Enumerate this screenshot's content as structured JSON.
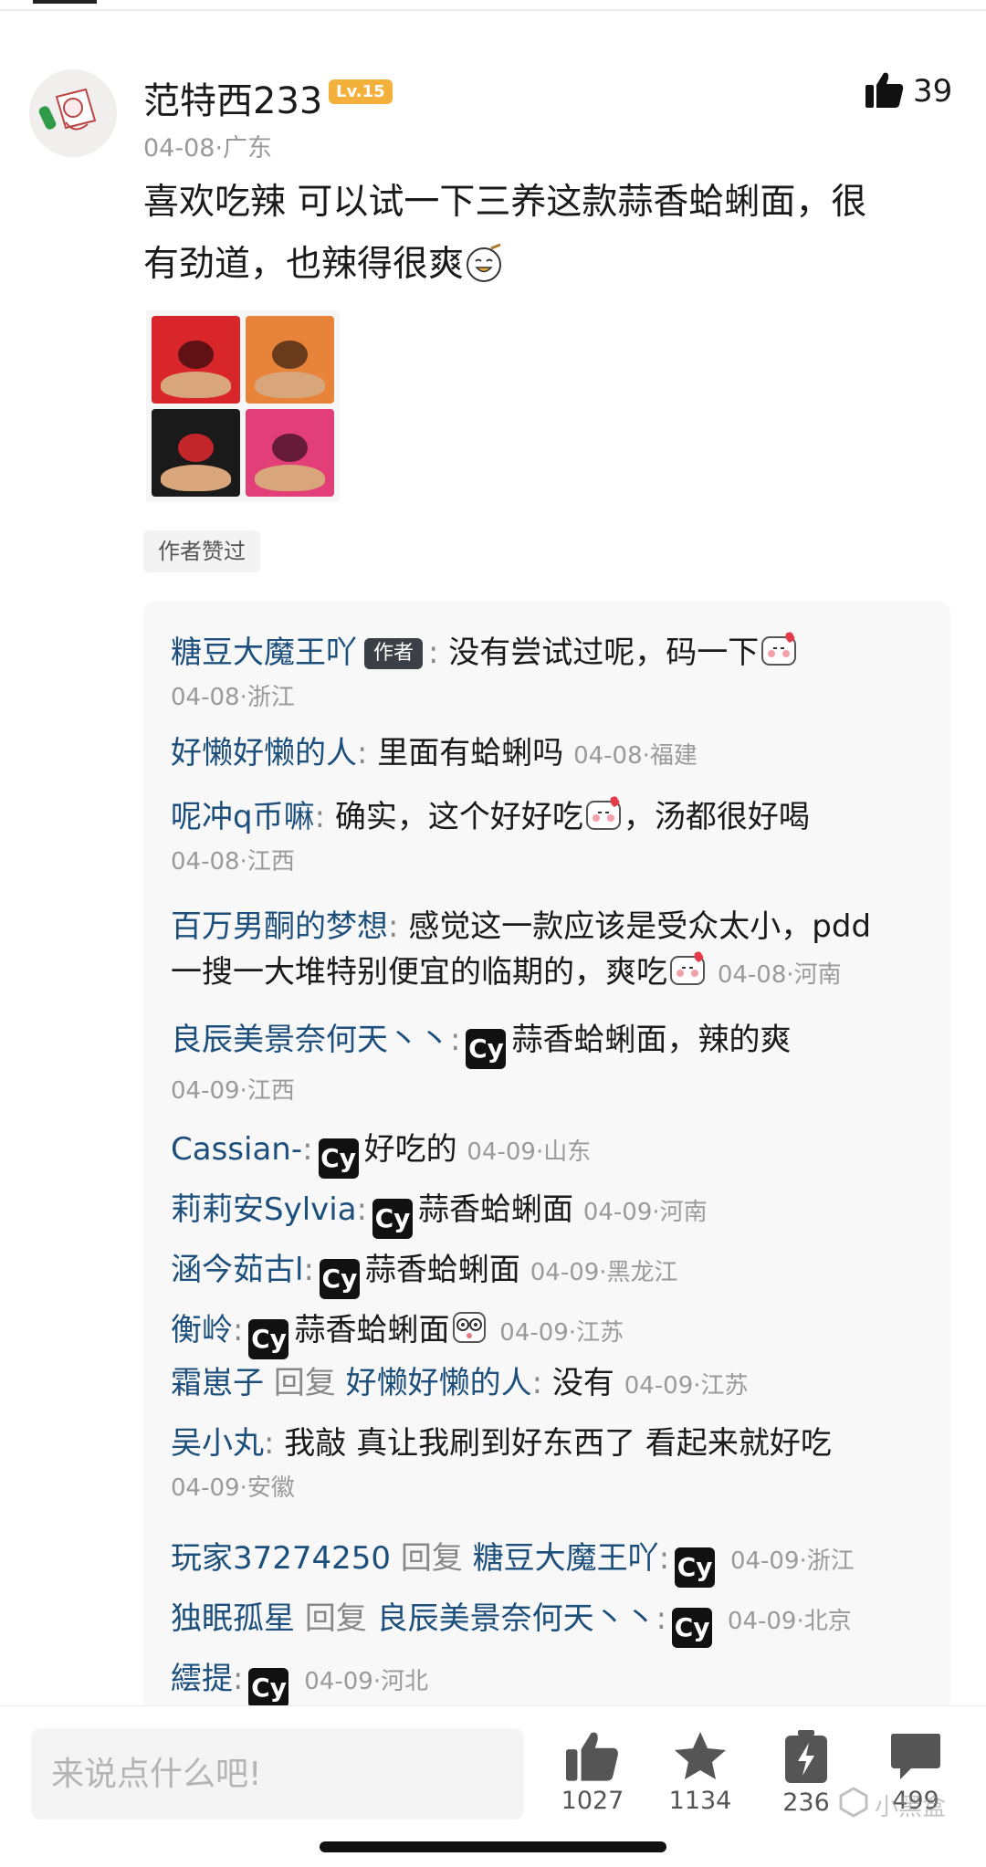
{
  "post": {
    "username": "范特西233",
    "level": "Lv.15",
    "like_count": "39",
    "date": "04-08",
    "location": "广东",
    "text_line1": "喜欢吃辣 可以试一下三养这款蒜香蛤蜊面，很",
    "text_line2": "有劲道，也辣得很爽",
    "author_liked": "作者赞过"
  },
  "replies": [
    {
      "name": "糖豆大魔王吖",
      "tag": "作者",
      "sep": ":",
      "text": "没有尝试过呢，码一下",
      "time": "04-08·浙江"
    },
    {
      "name": "好懒好懒的人",
      "sep": ":",
      "text": "里面有蛤蜊吗",
      "time": "04-08·福建"
    },
    {
      "name": "呢冲q币嘛",
      "sep": ":",
      "text": "确实，这个好好吃",
      "text2": "，汤都很好喝",
      "time": "04-08·江西"
    },
    {
      "name": "百万男酮的梦想",
      "sep": ":",
      "text": "感觉这一款应该是受众太小，pdd",
      "text2": "一搜一大堆特别便宜的临期的，爽吃",
      "time": "04-08·河南"
    },
    {
      "name": "良辰美景奈何天丶丶",
      "sep": ":",
      "cy": "Cy",
      "text": "蒜香蛤蜊面，辣的爽",
      "time": "04-09·江西"
    },
    {
      "name": "Cassian-",
      "sep": ":",
      "cy": "Cy",
      "text": "好吃的",
      "time": "04-09·山东"
    },
    {
      "name": "莉莉安Sylvia",
      "sep": ":",
      "cy": "Cy",
      "text": "蒜香蛤蜊面",
      "time": "04-09·河南"
    },
    {
      "name": "涵今茹古l",
      "sep": ":",
      "cy": "Cy",
      "text": "蒜香蛤蜊面",
      "time": "04-09·黑龙江"
    },
    {
      "name": "衡岭",
      "sep": ":",
      "cy": "Cy",
      "text": "蒜香蛤蜊面",
      "time": "04-09·江苏"
    },
    {
      "name": "霜崽子",
      "reply_word": "回复",
      "reply_to": "好懒好懒的人",
      "sep": ":",
      "text": "没有",
      "time": "04-09·江苏"
    },
    {
      "name": "吴小丸",
      "sep": ":",
      "text": "我敲 真让我刷到好东西了 看起来就好吃",
      "time": "04-09·安徽"
    },
    {
      "name": "玩家37274250",
      "reply_word": "回复",
      "reply_to": "糖豆大魔王吖",
      "sep": ":",
      "cy": "Cy",
      "time": "04-09·浙江"
    },
    {
      "name": "独眠孤星",
      "reply_word": "回复",
      "reply_to": "良辰美景奈何天丶丶",
      "sep": ":",
      "cy": "Cy",
      "time": "04-09·北京"
    },
    {
      "name": "繧提",
      "sep": ":",
      "cy": "Cy",
      "time": "04-09·河北"
    }
  ],
  "bottom": {
    "input_placeholder": "来说点什么吧!",
    "like_count": "1027",
    "favorite_count": "1134",
    "charge_count": "236",
    "comment_count": "499",
    "watermark": "小黑盒"
  },
  "colors": {
    "name_blue": "#1d4f7c",
    "level_badge": "#f3b13b",
    "meta_grey": "#9a9a9a"
  },
  "icons": [
    "thumbs-up-icon",
    "star-icon",
    "charge-icon",
    "comment-bubble-icon",
    "cy-sticker-icon",
    "blush-emoji-icon"
  ]
}
